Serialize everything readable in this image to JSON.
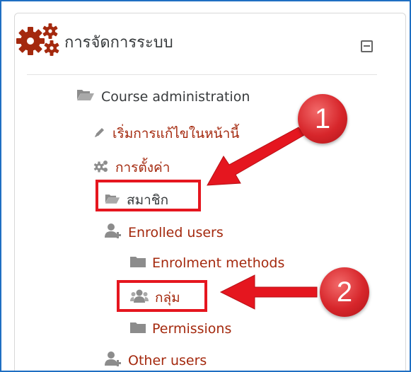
{
  "block": {
    "title": "การจัดการระบบ",
    "collapse_icon": "minus-square-icon",
    "accent_color": "#a4290e"
  },
  "tree": {
    "course_admin": {
      "label": "Course administration",
      "icon": "folder-open-icon"
    },
    "edit": {
      "label": "เริ่มการแก้ไขในหน้านี้",
      "icon": "pencil-icon"
    },
    "settings": {
      "label": "การตั้งค่า",
      "icon": "gear-icon"
    },
    "members": {
      "label": "สมาชิก",
      "icon": "folder-open-icon"
    },
    "enrolled_users": {
      "label": "Enrolled users",
      "icon": "user-plus-icon"
    },
    "enrolment_methods": {
      "label": "Enrolment methods",
      "icon": "folder-icon"
    },
    "groups": {
      "label": "กลุ่ม",
      "icon": "users-icon"
    },
    "permissions": {
      "label": "Permissions",
      "icon": "folder-icon"
    },
    "other_users": {
      "label": "Other users",
      "icon": "user-plus-icon"
    }
  },
  "annotations": {
    "step1": "1",
    "step2": "2",
    "highlight_color": "#e5161f"
  }
}
